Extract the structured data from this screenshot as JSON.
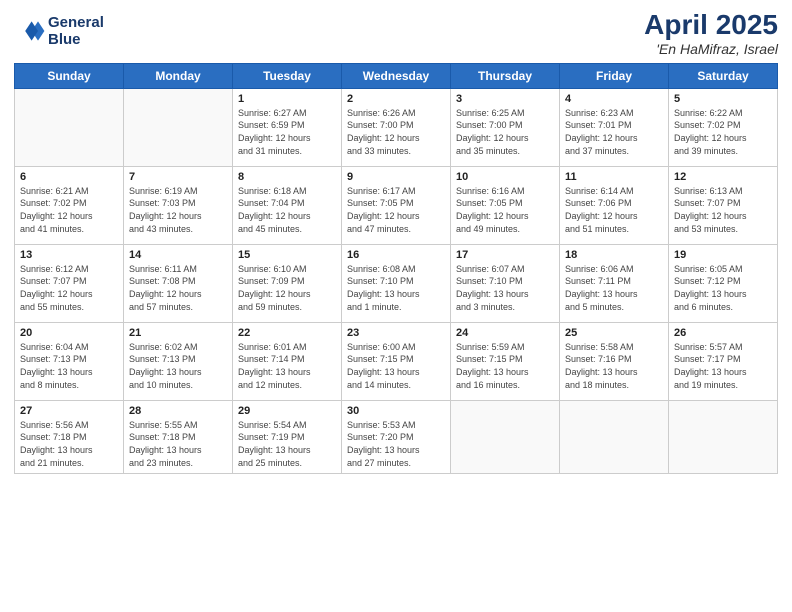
{
  "header": {
    "logo_line1": "General",
    "logo_line2": "Blue",
    "month": "April 2025",
    "location": "'En HaMifraz, Israel"
  },
  "weekdays": [
    "Sunday",
    "Monday",
    "Tuesday",
    "Wednesday",
    "Thursday",
    "Friday",
    "Saturday"
  ],
  "weeks": [
    [
      {
        "day": "",
        "info": ""
      },
      {
        "day": "",
        "info": ""
      },
      {
        "day": "1",
        "info": "Sunrise: 6:27 AM\nSunset: 6:59 PM\nDaylight: 12 hours\nand 31 minutes."
      },
      {
        "day": "2",
        "info": "Sunrise: 6:26 AM\nSunset: 7:00 PM\nDaylight: 12 hours\nand 33 minutes."
      },
      {
        "day": "3",
        "info": "Sunrise: 6:25 AM\nSunset: 7:00 PM\nDaylight: 12 hours\nand 35 minutes."
      },
      {
        "day": "4",
        "info": "Sunrise: 6:23 AM\nSunset: 7:01 PM\nDaylight: 12 hours\nand 37 minutes."
      },
      {
        "day": "5",
        "info": "Sunrise: 6:22 AM\nSunset: 7:02 PM\nDaylight: 12 hours\nand 39 minutes."
      }
    ],
    [
      {
        "day": "6",
        "info": "Sunrise: 6:21 AM\nSunset: 7:02 PM\nDaylight: 12 hours\nand 41 minutes."
      },
      {
        "day": "7",
        "info": "Sunrise: 6:19 AM\nSunset: 7:03 PM\nDaylight: 12 hours\nand 43 minutes."
      },
      {
        "day": "8",
        "info": "Sunrise: 6:18 AM\nSunset: 7:04 PM\nDaylight: 12 hours\nand 45 minutes."
      },
      {
        "day": "9",
        "info": "Sunrise: 6:17 AM\nSunset: 7:05 PM\nDaylight: 12 hours\nand 47 minutes."
      },
      {
        "day": "10",
        "info": "Sunrise: 6:16 AM\nSunset: 7:05 PM\nDaylight: 12 hours\nand 49 minutes."
      },
      {
        "day": "11",
        "info": "Sunrise: 6:14 AM\nSunset: 7:06 PM\nDaylight: 12 hours\nand 51 minutes."
      },
      {
        "day": "12",
        "info": "Sunrise: 6:13 AM\nSunset: 7:07 PM\nDaylight: 12 hours\nand 53 minutes."
      }
    ],
    [
      {
        "day": "13",
        "info": "Sunrise: 6:12 AM\nSunset: 7:07 PM\nDaylight: 12 hours\nand 55 minutes."
      },
      {
        "day": "14",
        "info": "Sunrise: 6:11 AM\nSunset: 7:08 PM\nDaylight: 12 hours\nand 57 minutes."
      },
      {
        "day": "15",
        "info": "Sunrise: 6:10 AM\nSunset: 7:09 PM\nDaylight: 12 hours\nand 59 minutes."
      },
      {
        "day": "16",
        "info": "Sunrise: 6:08 AM\nSunset: 7:10 PM\nDaylight: 13 hours\nand 1 minute."
      },
      {
        "day": "17",
        "info": "Sunrise: 6:07 AM\nSunset: 7:10 PM\nDaylight: 13 hours\nand 3 minutes."
      },
      {
        "day": "18",
        "info": "Sunrise: 6:06 AM\nSunset: 7:11 PM\nDaylight: 13 hours\nand 5 minutes."
      },
      {
        "day": "19",
        "info": "Sunrise: 6:05 AM\nSunset: 7:12 PM\nDaylight: 13 hours\nand 6 minutes."
      }
    ],
    [
      {
        "day": "20",
        "info": "Sunrise: 6:04 AM\nSunset: 7:13 PM\nDaylight: 13 hours\nand 8 minutes."
      },
      {
        "day": "21",
        "info": "Sunrise: 6:02 AM\nSunset: 7:13 PM\nDaylight: 13 hours\nand 10 minutes."
      },
      {
        "day": "22",
        "info": "Sunrise: 6:01 AM\nSunset: 7:14 PM\nDaylight: 13 hours\nand 12 minutes."
      },
      {
        "day": "23",
        "info": "Sunrise: 6:00 AM\nSunset: 7:15 PM\nDaylight: 13 hours\nand 14 minutes."
      },
      {
        "day": "24",
        "info": "Sunrise: 5:59 AM\nSunset: 7:15 PM\nDaylight: 13 hours\nand 16 minutes."
      },
      {
        "day": "25",
        "info": "Sunrise: 5:58 AM\nSunset: 7:16 PM\nDaylight: 13 hours\nand 18 minutes."
      },
      {
        "day": "26",
        "info": "Sunrise: 5:57 AM\nSunset: 7:17 PM\nDaylight: 13 hours\nand 19 minutes."
      }
    ],
    [
      {
        "day": "27",
        "info": "Sunrise: 5:56 AM\nSunset: 7:18 PM\nDaylight: 13 hours\nand 21 minutes."
      },
      {
        "day": "28",
        "info": "Sunrise: 5:55 AM\nSunset: 7:18 PM\nDaylight: 13 hours\nand 23 minutes."
      },
      {
        "day": "29",
        "info": "Sunrise: 5:54 AM\nSunset: 7:19 PM\nDaylight: 13 hours\nand 25 minutes."
      },
      {
        "day": "30",
        "info": "Sunrise: 5:53 AM\nSunset: 7:20 PM\nDaylight: 13 hours\nand 27 minutes."
      },
      {
        "day": "",
        "info": ""
      },
      {
        "day": "",
        "info": ""
      },
      {
        "day": "",
        "info": ""
      }
    ]
  ]
}
